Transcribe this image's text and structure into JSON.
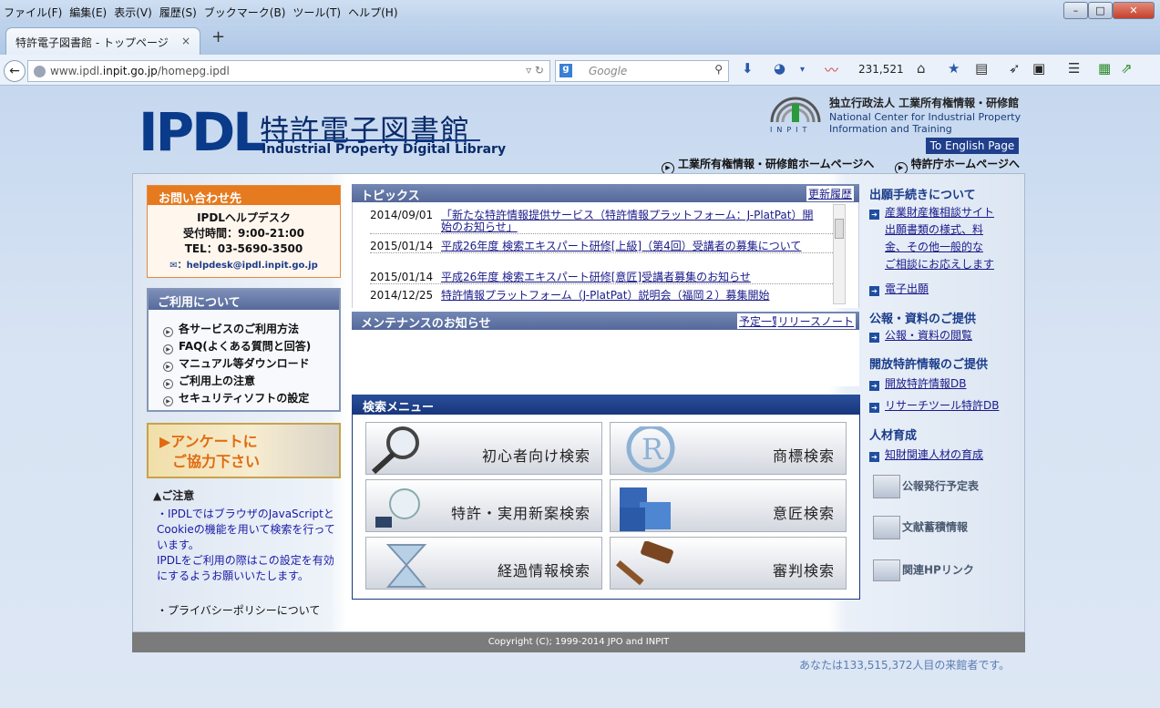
{
  "browser": {
    "menu": [
      "ファイル(F)",
      "編集(E)",
      "表示(V)",
      "履歴(S)",
      "ブックマーク(B)",
      "ツール(T)",
      "ヘルプ(H)"
    ],
    "tab_title": "特許電子図書館 - トップページ",
    "tab_close": "×",
    "new_tab": "+",
    "url_prefix": "www.ipdl.",
    "url_host": "inpit.go.jp",
    "url_path": "/homepg.ipdl",
    "search_placeholder": "Google",
    "counter": "231,521"
  },
  "header": {
    "logo_ipdl": "IPDL",
    "logo_jp": "特許電子図書館",
    "logo_en": "Industrial Property Digital Library",
    "inpit_name": "独立行政法人 工業所有権情報・研修館",
    "inpit_en1": "National Center for Industrial Property",
    "inpit_en2": "Information and Training",
    "inpit_word": "INPIT",
    "english_link": "To English Page",
    "link_inpit": "工業所有権情報・研修館ホームページへ",
    "link_jpo": "特許庁ホームページへ"
  },
  "contact": {
    "heading": "お問い合わせ先",
    "line1": "IPDLヘルプデスク",
    "line2": "受付時間：9:00-21:00",
    "line3": "TEL：03-5690-3500",
    "email": "：helpdesk@ipdl.inpit.go.jp"
  },
  "usage": {
    "heading": "ご利用について",
    "items": [
      "各サービスのご利用方法",
      "FAQ(よくある質問と回答)",
      "マニュアル等ダウンロード",
      "ご利用上の注意",
      "セキュリティソフトの設定"
    ]
  },
  "survey": {
    "line1": "▶アンケートに",
    "line2": "ご協力下さい"
  },
  "caution": {
    "heading": "ご注意",
    "text1": "・IPDLではブラウザのJavaScriptとCookieの機能を用いて検索を行っています。",
    "text2": "IPDLをご利用の際はこの設定を有効にするようお願いいたします。",
    "privacy": "・プライバシーポリシーについて"
  },
  "topics": {
    "heading": "トピックス",
    "history_link": "更新履歴",
    "items": [
      {
        "date": "2014/09/01",
        "title": "「新たな特許情報提供サービス（特許情報プラットフォーム：J-PlatPat）開始のお知らせ」"
      },
      {
        "date": "2015/01/14",
        "title": "平成26年度 検索エキスパート研修[上級]（第4回）受講者の募集について"
      },
      {
        "date": "2015/01/14",
        "title": "平成26年度 検索エキスパート研修[意匠]受講者募集のお知らせ"
      },
      {
        "date": "2014/12/25",
        "title": "特許情報プラットフォーム（J-PlatPat）説明会（福岡２）募集開始"
      }
    ]
  },
  "maintenance": {
    "heading": "メンテナンスのお知らせ",
    "schedule_link": "予定一覧",
    "release_link": "リリースノート"
  },
  "search_menu": {
    "heading": "検索メニュー",
    "buttons": [
      "初心者向け検索",
      "商標検索",
      "特許・実用新案検索",
      "意匠検索",
      "経過情報検索",
      "審判検索"
    ]
  },
  "right": {
    "apply_heading": "出願手続きについて",
    "apply_link1": "産業財産権相談サイト",
    "apply_link1b": "出願書類の様式、料",
    "apply_link1c": "金、その他一般的な",
    "apply_link1d": "ご相談にお応えします",
    "apply_link2": "電子出願",
    "gazette_heading": "公報・資料のご提供",
    "gazette_link": "公報・資料の閲覧",
    "open_heading": "開放特許情報のご提供",
    "open_link1": "開放特許情報DB",
    "open_link2": "リサーチツール特許DB",
    "hr_heading": "人材育成",
    "hr_link": "知財関連人材の育成",
    "icon1": "公報発行予定表",
    "icon2": "文献蓄積情報",
    "icon3": "関連HPリンク"
  },
  "footer": {
    "copyright": "Copyright (C); 1999-2014  JPO and INPIT",
    "visitor": "あなたは133,515,372人目の来館者です。"
  }
}
